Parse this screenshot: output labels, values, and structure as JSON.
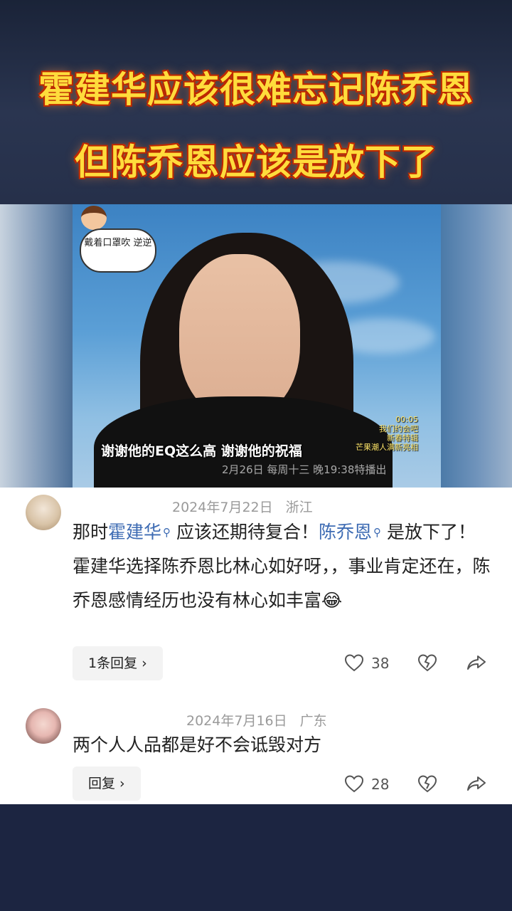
{
  "headline": {
    "line1": "霍建华应该很难忘记陈乔恩",
    "line2": "但陈乔恩应该是放下了"
  },
  "video": {
    "sticker_text": "戴着口罩吹 逆逆",
    "subtitle": "谢谢他的EQ这么高  谢谢他的祝福",
    "logo_lines": [
      "00:05",
      "我们约会吧",
      "新春特辑",
      "芒果潮人满新亮相"
    ],
    "ticker": "2月26日  每周十三  晚19:38特播出"
  },
  "comments": [
    {
      "date": "2024年7月22日",
      "location": "浙江",
      "text_parts": {
        "p1": "那时",
        "link1": "霍建华",
        "p2": " 应该还期待复合！",
        "link2": "陈乔恩",
        "p3": " 是放下了！霍建华选择陈乔恩比林心如好呀，，事业肯定还在，陈乔恩感情经历也没有林心如丰富",
        "emoji": "😂"
      },
      "reply_label": "1条回复 ›",
      "likes": "38"
    },
    {
      "date": "2024年7月16日",
      "location": "广东",
      "text": "两个人人品都是好不会诋毁对方",
      "reply_label": "回复 ›",
      "likes": "28"
    }
  ],
  "colors": {
    "link": "#3d6bb3",
    "headline": "#ffdc3c",
    "page_bg": "#1b2540"
  },
  "icons": [
    "heart-icon",
    "dislike-heart-icon",
    "share-icon",
    "search-icon"
  ]
}
